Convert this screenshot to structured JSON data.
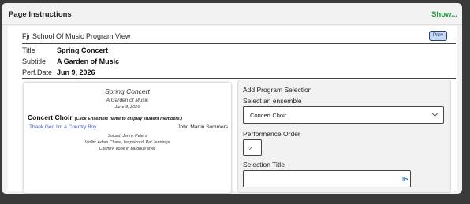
{
  "panel": {
    "title": "Page Instructions",
    "show_label": "Show..."
  },
  "program_view": {
    "heading": "Fjr School Of Music Program View",
    "prev_label": "Prev",
    "meta": [
      {
        "key": "Title",
        "value": "Spring Concert"
      },
      {
        "key": "Subtitle",
        "value": "A Garden of Music"
      },
      {
        "key": "Perf.Date",
        "value": "Jun 9, 2026"
      }
    ]
  },
  "preview": {
    "title": "Spring Concert",
    "subtitle": "A Garden of Music",
    "date": "June 9, 2026",
    "ensemble": "Concert Choir",
    "ensemble_hint": "(Click Ensemble name to display student members.)",
    "piece": "Thank God I'm A Country Boy",
    "composer": "John Martin Sommers",
    "notes": [
      "Soloist: Jenny Peters",
      "Violin: Adam Chase, harpsicord: Pat Jennings",
      "Country, done in baroque style"
    ]
  },
  "form": {
    "heading": "Add Program Selection",
    "ensemble_label": "Select an ensemble",
    "ensemble_value": "Concert Choir",
    "order_label": "Performance Order",
    "order_value": "2",
    "selection_title_label": "Selection Title",
    "selection_title_value": ""
  },
  "colors": {
    "accent_link": "#1a9a3c",
    "prev_button_bg": "#c9d9f5",
    "prev_button_border": "#27407a",
    "piece_link": "#3b5fc0"
  }
}
